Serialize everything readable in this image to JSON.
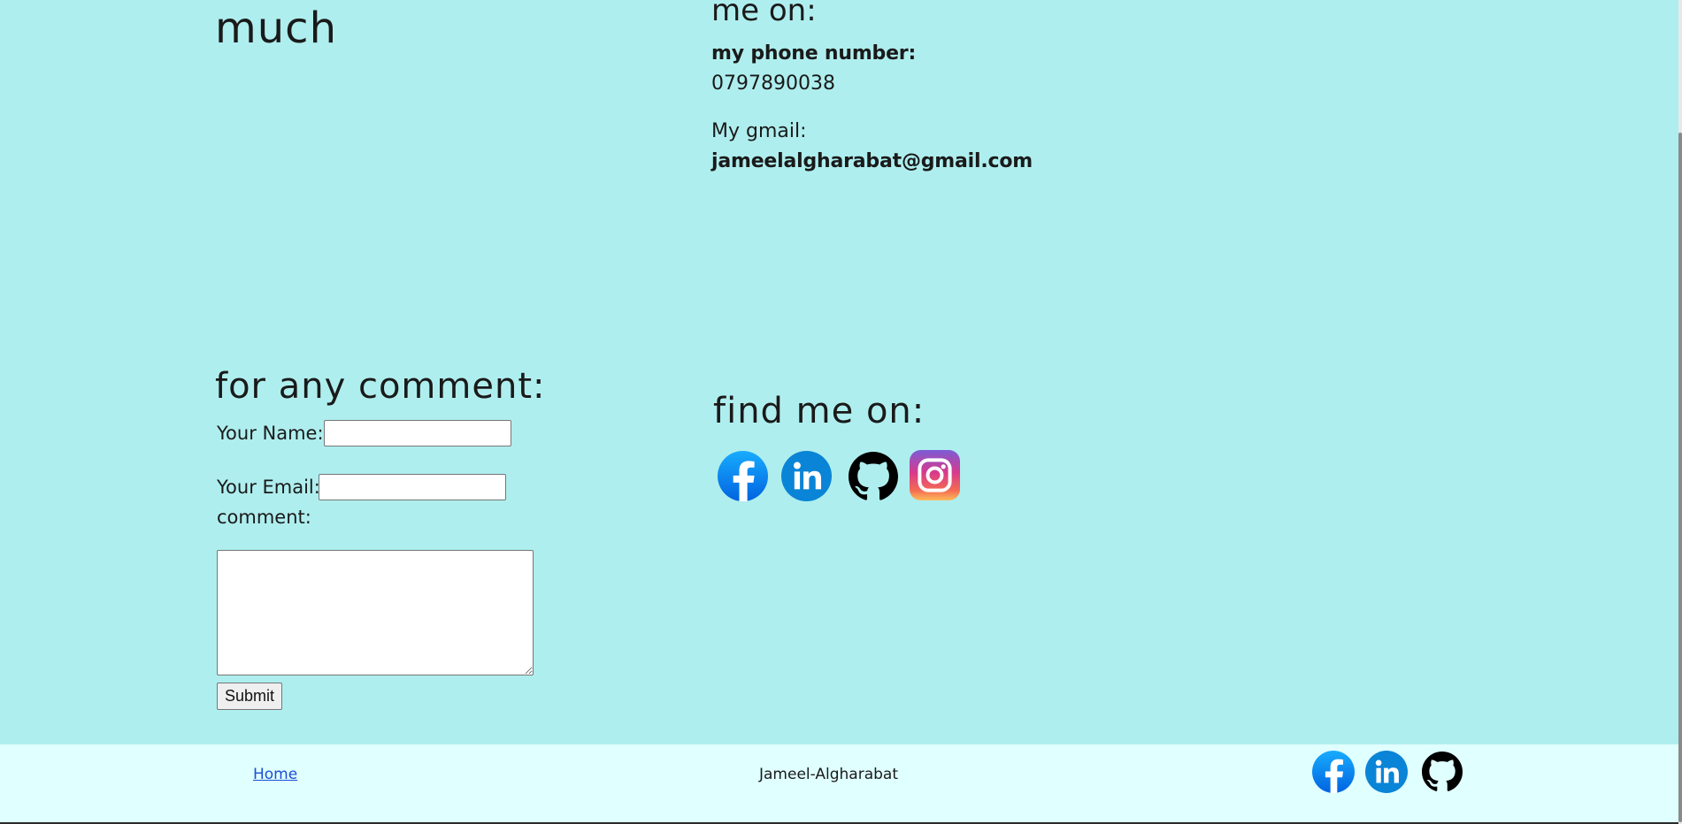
{
  "hero": {
    "partial_line": "much"
  },
  "contact": {
    "partial_heading": "me on:",
    "phone_label": "my phone number:",
    "phone_value": "0797890038",
    "gmail_label": "My gmail:",
    "gmail_value": "jameelalgharabat@gmail.com"
  },
  "comment_form": {
    "title": "for any comment:",
    "name_label": "Your Name:",
    "name_value": "",
    "email_label": "Your Email:",
    "email_value": "",
    "comment_label": "comment:",
    "comment_value": "",
    "submit_label": "Submit"
  },
  "find_me": {
    "title": "find me on:",
    "links": [
      {
        "name": "facebook",
        "icon": "facebook-icon",
        "color": "#1877f2"
      },
      {
        "name": "linkedin",
        "icon": "linkedin-icon",
        "color": "#0a84d6"
      },
      {
        "name": "github",
        "icon": "github-icon",
        "color": "#000000"
      },
      {
        "name": "instagram",
        "icon": "instagram-icon",
        "color": "#d6249f"
      }
    ]
  },
  "footer": {
    "home_link": "Home",
    "author": "Jameel-Algharabat",
    "links": [
      {
        "name": "facebook",
        "icon": "facebook-icon"
      },
      {
        "name": "linkedin",
        "icon": "linkedin-icon"
      },
      {
        "name": "github",
        "icon": "github-icon"
      }
    ]
  },
  "colors": {
    "page_background": "#afeeee",
    "footer_background": "#e0ffff",
    "link": "#1a4fd6",
    "text": "#1a1a1a"
  }
}
